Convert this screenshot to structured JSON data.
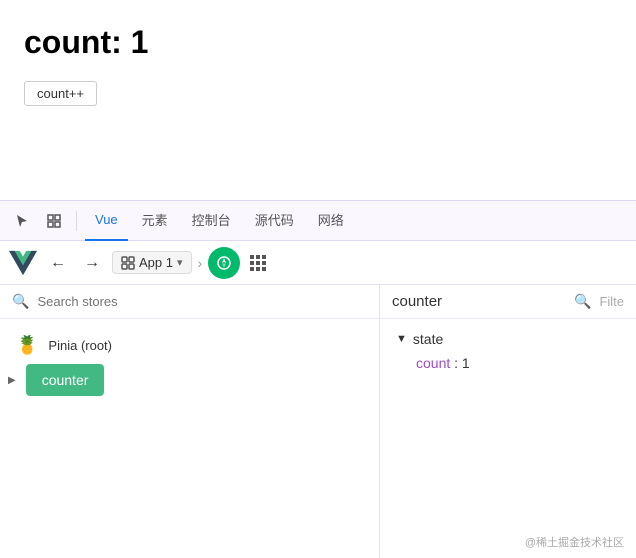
{
  "app": {
    "count_label": "count: 1",
    "button_label": "count++"
  },
  "devtools": {
    "toolbar": {
      "tabs": [
        "Vue",
        "元素",
        "控制台",
        "源代码",
        "网络"
      ],
      "active_tab": "Vue"
    },
    "vue_toolbar": {
      "back_arrow": "←",
      "forward_arrow": "→",
      "component_name": "App 1",
      "nav_arrow": "›"
    },
    "left_panel": {
      "search_placeholder": "Search stores",
      "stores": [
        {
          "name": "Pinia (root)",
          "emoji": "🍍"
        }
      ],
      "selected_store": "counter"
    },
    "right_panel": {
      "title": "counter",
      "filter_label": "Filte",
      "state": {
        "label": "state",
        "items": [
          {
            "key": "count",
            "value": "1"
          }
        ]
      }
    }
  },
  "watermark": "@稀土掘金技术社区"
}
